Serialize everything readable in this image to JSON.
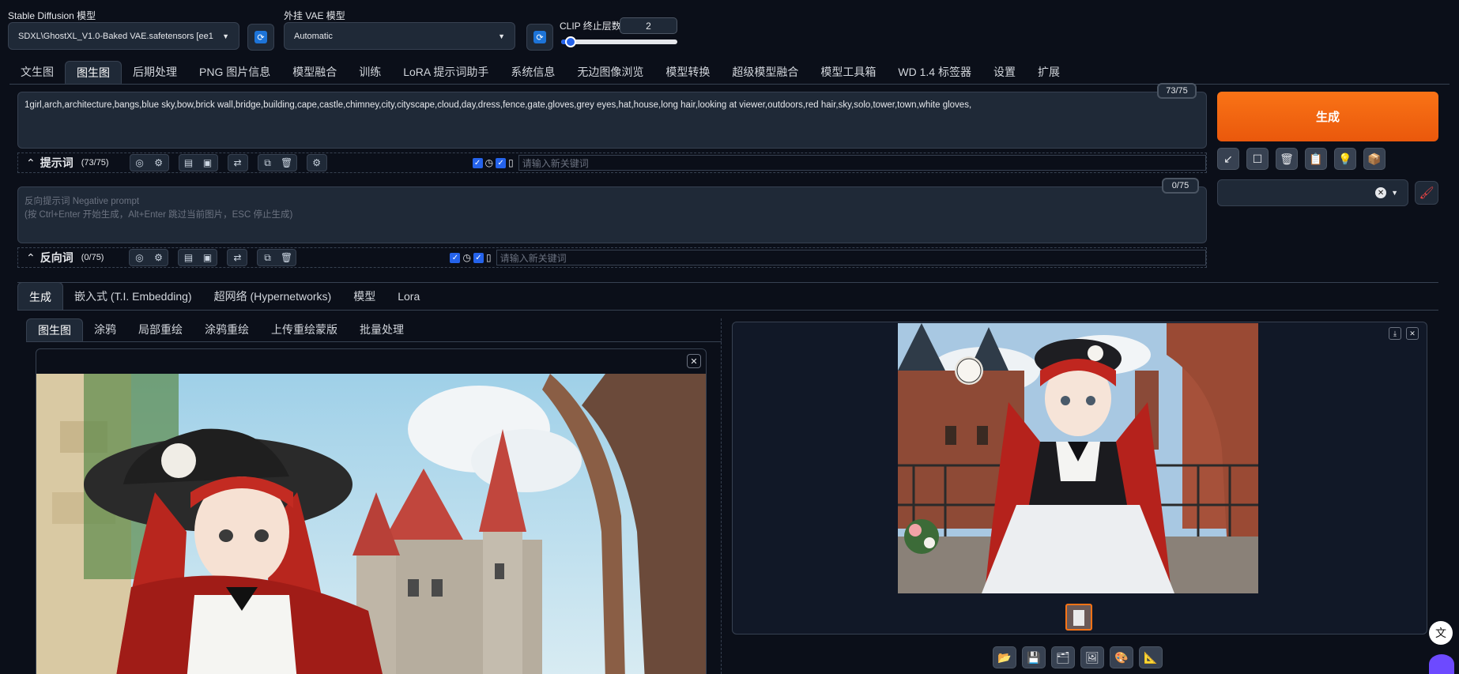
{
  "top": {
    "sd_model_label": "Stable Diffusion 模型",
    "sd_model_value": "SDXL\\GhostXL_V1.0-Baked VAE.safetensors [ee1",
    "vae_label": "外挂 VAE 模型",
    "vae_value": "Automatic",
    "clip_label": "CLIP 终止层数",
    "clip_value": "2",
    "clip_fraction": 0.083
  },
  "main_tabs": [
    "文生图",
    "图生图",
    "后期处理",
    "PNG 图片信息",
    "模型融合",
    "训练",
    "LoRA 提示词助手",
    "系统信息",
    "无边图像浏览",
    "模型转换",
    "超级模型融合",
    "模型工具箱",
    "WD 1.4 标签器",
    "设置",
    "扩展"
  ],
  "prompt": {
    "text": "1girl,arch,architecture,bangs,blue sky,bow,brick wall,bridge,building,cape,castle,chimney,city,cityscape,cloud,day,dress,fence,gate,gloves,grey eyes,hat,house,long hair,looking at viewer,outdoors,red hair,sky,solo,tower,town,white gloves,",
    "counter": "73/75",
    "label": "提示词",
    "count": "(73/75)",
    "keyword_placeholder": "请输入新关键词"
  },
  "negative": {
    "placeholder_line1": "反向提示词 Negative prompt",
    "placeholder_line2": "(按 Ctrl+Enter 开始生成，Alt+Enter 跳过当前图片，ESC 停止生成)",
    "counter": "0/75",
    "label": "反向词",
    "count": "(0/75)",
    "keyword_placeholder": "请输入新关键词"
  },
  "generate_label": "生成",
  "sub_tabs": [
    "生成",
    "嵌入式 (T.I. Embedding)",
    "超网络 (Hypernetworks)",
    "模型",
    "Lora"
  ],
  "img_tabs": [
    "图生图",
    "涂鸦",
    "局部重绘",
    "涂鸦重绘",
    "上传重绘蒙版",
    "批量处理"
  ],
  "icons": {
    "action_buttons": [
      "arrow-icon",
      "square-icon",
      "trash-icon",
      "clipboard-icon",
      "bulb-icon",
      "box-icon"
    ],
    "image_buttons": [
      "folder-icon",
      "save-icon",
      "zip-icon",
      "image-icon",
      "palette-icon",
      "ruler-icon"
    ]
  },
  "colors": {
    "generate_start": "#f97316",
    "generate_end": "#ea580c",
    "accent_blue": "#2563eb",
    "bg": "#0b0f19",
    "panel": "#1f2937"
  }
}
